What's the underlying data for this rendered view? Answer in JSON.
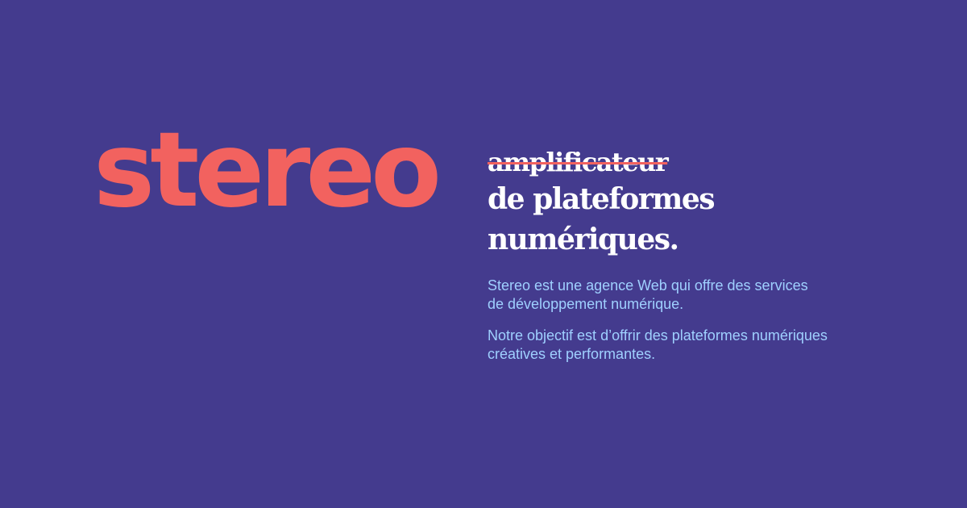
{
  "brand": {
    "logo_text": "stereo"
  },
  "headline": {
    "struck_word": "amplificateur",
    "line_2": "de plateformes",
    "line_3": "numériques."
  },
  "description": {
    "paragraph_1_line_1": "Stereo est une agence Web qui offre des services",
    "paragraph_1_line_2": "de développement numérique.",
    "paragraph_2_line_1": "Notre objectif est d’offrir des plateformes numériques",
    "paragraph_2_line_2": "créatives et performantes."
  },
  "colors": {
    "background": "#443b8e",
    "brand_coral": "#f2625f",
    "headline_white": "#ffffff",
    "body_light_blue": "#9fd0ff"
  }
}
